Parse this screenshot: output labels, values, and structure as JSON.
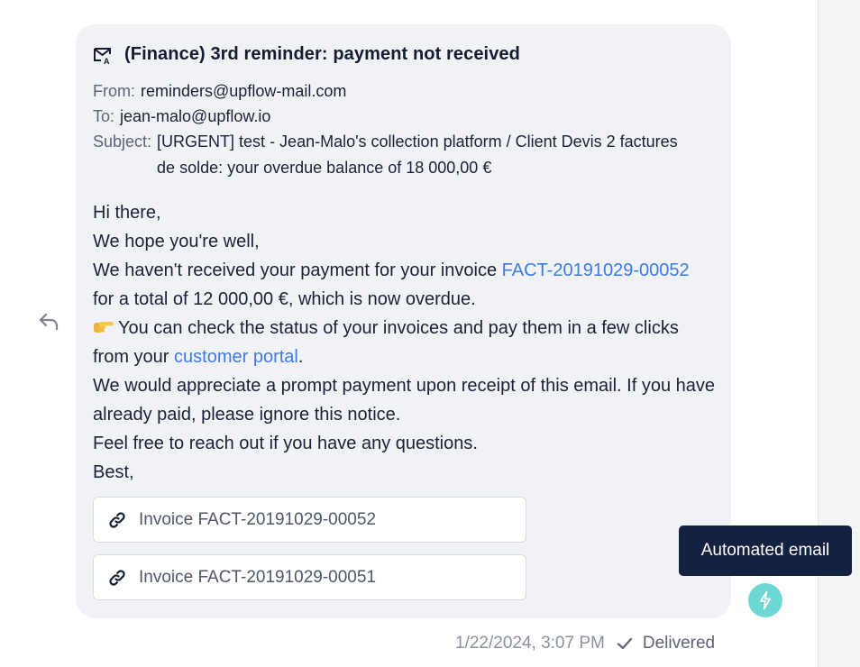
{
  "email": {
    "title": "(Finance) 3rd reminder: payment not received",
    "from_label": "From:",
    "from_value": "reminders@upflow-mail.com",
    "to_label": "To:",
    "to_value": "jean-malo@upflow.io",
    "subject_label": "Subject:",
    "subject_value": "[URGENT] test - Jean-Malo's collection platform / Client Devis 2 factures de solde: your overdue balance of 18 000,00 €",
    "body": {
      "greeting": "Hi there,",
      "line1": "We hope you're well,",
      "line2_before": "We haven't received your payment for your invoice ",
      "invoice_link": "FACT-20191029-00052",
      "line2_after": " for a total of 12 000,00 €, which is now overdue.",
      "line3_before": "You can check the status of your invoices and pay them in a few clicks from your ",
      "portal_link": "customer portal",
      "line3_after": ".",
      "line4": "We would appreciate a prompt payment upon receipt of this email. If you have already paid, please ignore this notice.",
      "line5": "Feel free to reach out if you have any questions.",
      "signoff": "Best,"
    },
    "attachments": [
      {
        "label": "Invoice FACT-20191029-00052"
      },
      {
        "label": "Invoice FACT-20191029-00051"
      }
    ]
  },
  "footer": {
    "timestamp": "1/22/2024, 3:07 PM",
    "status": "Delivered"
  },
  "tooltip": {
    "text": "Automated email"
  },
  "icons": {
    "reply": "reply-icon",
    "mail": "mail-icon",
    "emoji": "pointing-hand-emoji",
    "attachment": "link-icon",
    "check": "check-icon",
    "automation": "lightning-icon"
  },
  "colors": {
    "link": "#3d7be8",
    "card_background": "#f1f2f6",
    "tooltip_background": "#152141",
    "automation_badge": "#6dd7d3"
  }
}
